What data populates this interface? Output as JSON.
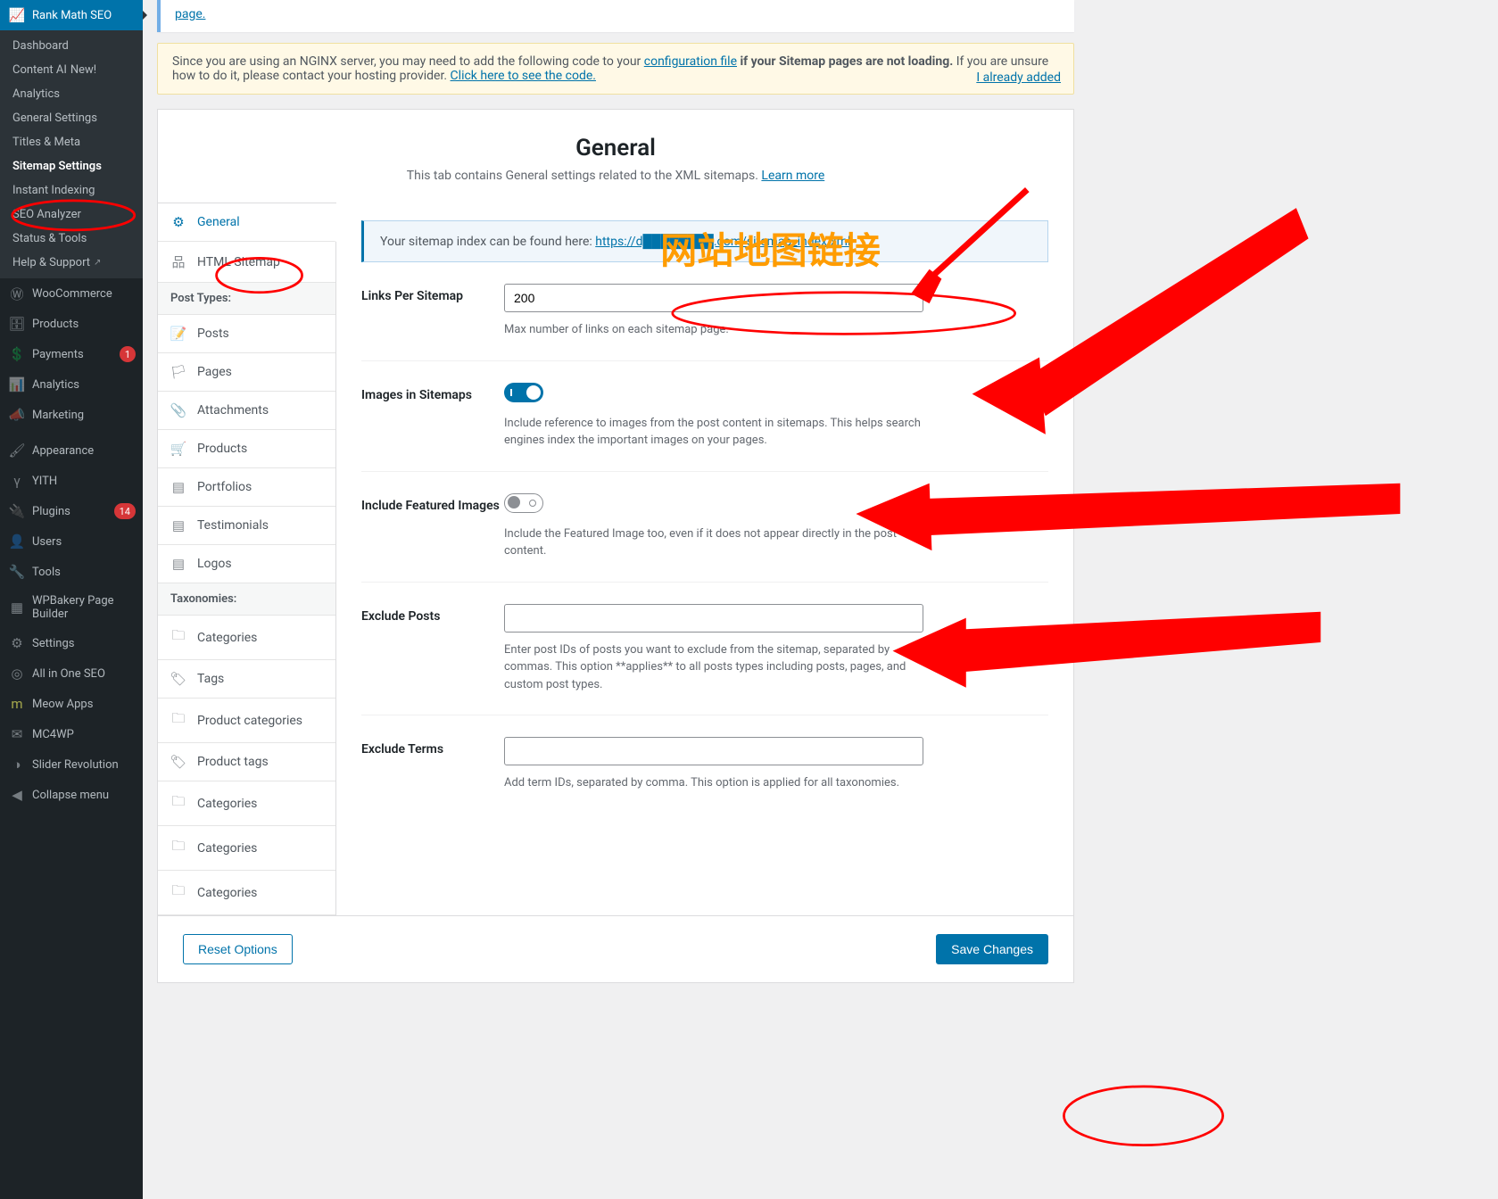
{
  "annotation_text": "网站地图链接",
  "wp_menu": {
    "rank_math": {
      "title": "Rank Math SEO",
      "sub": [
        {
          "label": "Dashboard"
        },
        {
          "label": "Content AI",
          "new": "New!"
        },
        {
          "label": "Analytics",
          "dot": true
        },
        {
          "label": "General Settings"
        },
        {
          "label": "Titles & Meta"
        },
        {
          "label": "Sitemap Settings",
          "selected": true
        },
        {
          "label": "Instant Indexing"
        },
        {
          "label": "SEO Analyzer"
        },
        {
          "label": "Status & Tools"
        },
        {
          "label": "Help & Support",
          "ext": true
        }
      ]
    },
    "items": [
      {
        "icon": "woo",
        "label": "WooCommerce"
      },
      {
        "icon": "archive",
        "label": "Products"
      },
      {
        "icon": "cash",
        "label": "Payments",
        "badge": "1"
      },
      {
        "icon": "bars",
        "label": "Analytics"
      },
      {
        "icon": "megaphone",
        "label": "Marketing"
      },
      {
        "icon": "brush",
        "label": "Appearance"
      },
      {
        "icon": "yith",
        "label": "YITH"
      },
      {
        "icon": "plug",
        "label": "Plugins",
        "badge": "14"
      },
      {
        "icon": "user",
        "label": "Users"
      },
      {
        "icon": "wrench",
        "label": "Tools"
      },
      {
        "icon": "wpbakery",
        "label": "WPBakery Page Builder"
      },
      {
        "icon": "sliders",
        "label": "Settings"
      },
      {
        "icon": "aioseo",
        "label": "All in One SEO"
      },
      {
        "icon": "meow",
        "label": "Meow Apps"
      },
      {
        "icon": "mc4wp",
        "label": "MC4WP"
      },
      {
        "icon": "slider",
        "label": "Slider Revolution"
      },
      {
        "icon": "collapse",
        "label": "Collapse menu"
      }
    ]
  },
  "notice_top": {
    "text_end": "page."
  },
  "notice_nginx": {
    "pre": "Since you are using an NGINX server, you may need to add the following code to your ",
    "link1": "configuration file",
    "mid": " if your Sitemap pages are not loading.",
    "post": " If you are unsure how to do it, please contact your hosting provider. ",
    "link2": "Click here to see the code.",
    "already": "I already added"
  },
  "settings": {
    "title": "General",
    "desc": "This tab contains General settings related to the XML sitemaps. ",
    "learn_more": "Learn more"
  },
  "tabs": {
    "general": "General",
    "html_sitemap": "HTML Sitemap",
    "section_post_types": "Post Types:",
    "posts": "Posts",
    "pages": "Pages",
    "attachments": "Attachments",
    "products": "Products",
    "portfolios": "Portfolios",
    "testimonials": "Testimonials",
    "logos": "Logos",
    "section_taxonomies": "Taxonomies:",
    "categories": "Categories",
    "tags": "Tags",
    "product_categories": "Product categories",
    "product_tags": "Product tags",
    "cat2": "Categories",
    "cat3": "Categories",
    "cat4": "Categories"
  },
  "form": {
    "sitemap_intro": "Your sitemap index can be found here: ",
    "sitemap_url": "https://d████████.com/sitemap_index.xml",
    "links_per_sitemap": {
      "label": "Links Per Sitemap",
      "value": "200",
      "help": "Max number of links on each sitemap page."
    },
    "images_in_sitemaps": {
      "label": "Images in Sitemaps",
      "on": true,
      "help": "Include reference to images from the post content in sitemaps. This helps search engines index the important images on your pages."
    },
    "include_featured": {
      "label": "Include Featured Images",
      "on": false,
      "help": "Include the Featured Image too, even if it does not appear directly in the post content."
    },
    "exclude_posts": {
      "label": "Exclude Posts",
      "value": "",
      "help": "Enter post IDs of posts you want to exclude from the sitemap, separated by commas. This option **applies** to all posts types including posts, pages, and custom post types."
    },
    "exclude_terms": {
      "label": "Exclude Terms",
      "value": "",
      "help": "Add term IDs, separated by comma. This option is applied for all taxonomies."
    }
  },
  "footer": {
    "reset": "Reset Options",
    "save": "Save Changes"
  }
}
